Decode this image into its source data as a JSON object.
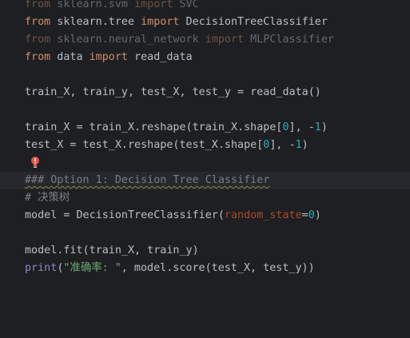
{
  "lines": [
    {
      "parts": [
        "from",
        " sklearn.svm ",
        "import",
        " SVC"
      ]
    },
    {
      "parts": [
        "from",
        " sklearn.tree ",
        "import",
        " DecisionTreeClassifier"
      ]
    },
    {
      "parts": [
        "from",
        " sklearn.neural_network ",
        "import",
        " MLPClassifier"
      ]
    },
    {
      "parts": [
        "from",
        " data ",
        "import",
        " read_data"
      ]
    },
    {
      "text": "train_X, train_y, test_X, test_y = read_data()"
    },
    {
      "parts": [
        "train_X = train_X.reshape(train_X.shape[",
        "0",
        "], -",
        "1",
        ")"
      ]
    },
    {
      "parts": [
        "test_X = test_X.reshape(test_X.shape[",
        "0",
        "], -",
        "1",
        ")"
      ]
    },
    {
      "text": "### Option 1: Decision Tree Classifier"
    },
    {
      "text": "# 决策树"
    },
    {
      "parts": [
        "model = DecisionTreeClassifier(",
        "random_state",
        "=",
        "0",
        ")"
      ]
    },
    {
      "text": "model.fit(train_X, train_y)"
    },
    {
      "parts": [
        "print",
        "(",
        "\"准确率: \"",
        ", model.score(test_X, test_y))"
      ]
    }
  ],
  "icons": {
    "intention": "red-lightbulb-icon"
  },
  "colors": {
    "background": "#1e1f22",
    "keyword": "#cf8e6d",
    "number": "#2aacb8",
    "string": "#6aab73",
    "param": "#aa4926",
    "comment": "#7a7e85"
  }
}
